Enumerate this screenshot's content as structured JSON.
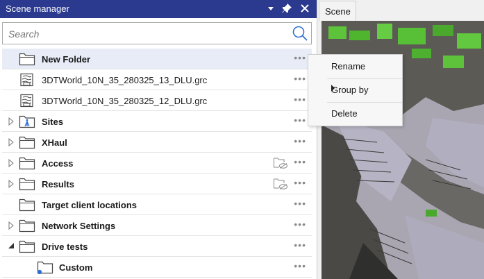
{
  "panel": {
    "title": "Scene manager"
  },
  "search": {
    "placeholder": "Search"
  },
  "tree": [
    {
      "label": "New Folder",
      "bold": true,
      "icon": "folder-icon",
      "expander": "none",
      "selected": true
    },
    {
      "label": "3DTWorld_10N_35_280325_13_DLU.grc",
      "bold": false,
      "icon": "map-file-icon",
      "expander": "none"
    },
    {
      "label": "3DTWorld_10N_35_280325_12_DLU.grc",
      "bold": false,
      "icon": "map-file-icon",
      "expander": "none"
    },
    {
      "label": "Sites",
      "bold": true,
      "icon": "sites-folder-icon",
      "expander": "collapsed"
    },
    {
      "label": "XHaul",
      "bold": true,
      "icon": "folder-icon",
      "expander": "collapsed"
    },
    {
      "label": "Access",
      "bold": true,
      "icon": "folder-icon",
      "expander": "collapsed",
      "hidden_icon": true
    },
    {
      "label": "Results",
      "bold": true,
      "icon": "folder-icon",
      "expander": "collapsed",
      "hidden_icon": true
    },
    {
      "label": "Target client locations",
      "bold": true,
      "icon": "folder-icon",
      "expander": "none"
    },
    {
      "label": "Network Settings",
      "bold": true,
      "icon": "folder-icon",
      "expander": "collapsed"
    },
    {
      "label": "Drive tests",
      "bold": true,
      "icon": "folder-icon",
      "expander": "expanded"
    },
    {
      "label": "Custom",
      "bold": true,
      "icon": "custom-folder-icon",
      "expander": "none",
      "indent": true
    }
  ],
  "more_label": "•••",
  "context_menu": [
    {
      "label": "Rename"
    },
    {
      "label": "Group by",
      "submenu": true
    },
    {
      "label": "Delete"
    }
  ],
  "scene_tab": {
    "label": "Scene"
  },
  "colors": {
    "titlebar": "#2b3a8f",
    "accent": "#2f6fd6",
    "selection": "#e7ecf7"
  }
}
